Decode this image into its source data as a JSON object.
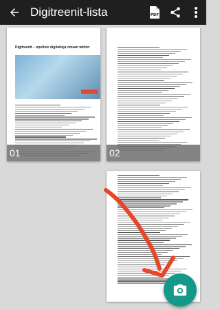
{
  "appbar": {
    "title": "Digitreenit-lista",
    "icons": [
      "back-arrow-icon",
      "pdf-icon",
      "share-icon",
      "more-vertical-icon"
    ],
    "pdf_label": "PDF",
    "bg_color": "#1f1f1f"
  },
  "pages": [
    {
      "number": "01",
      "heading": "Digitreenit – opettele digitaitoja omaan tahtiin"
    },
    {
      "number": "02"
    }
  ],
  "fab": {
    "icon": "camera-icon",
    "color": "#14988a"
  },
  "annotation": {
    "icon": "hand-drawn-arrow-icon",
    "color": "#e8462a"
  }
}
